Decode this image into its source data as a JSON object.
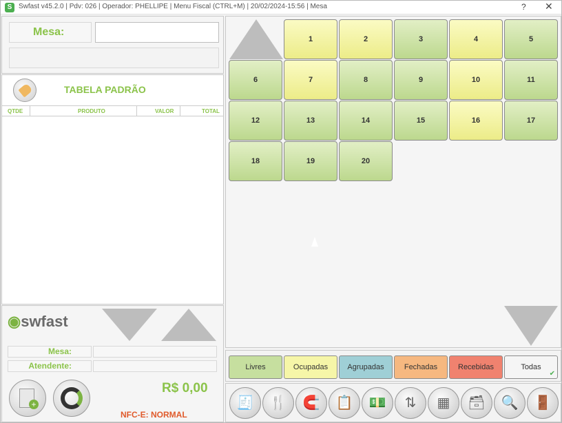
{
  "titlebar": {
    "title": "Swfast v45.2.0 | Pdv: 026 | Operador: PHELLIPE | Menu Fiscal (CTRL+M) | 20/02/2024-15:56 | Mesa",
    "help": "?",
    "close": "✕"
  },
  "left": {
    "mesa_label": "Mesa:",
    "table_title": "TABELA PADRÃO",
    "columns": [
      "QTDE",
      "PRODUTO",
      "VALOR",
      "TOTAL"
    ],
    "brand": "swfast",
    "info_mesa": "Mesa:",
    "info_atendente": "Atendente:",
    "total": "R$ 0,00",
    "nfce": "NFC-E: NORMAL"
  },
  "mesas": [
    {
      "n": "1",
      "status": "ocupada"
    },
    {
      "n": "2",
      "status": "ocupada"
    },
    {
      "n": "3",
      "status": "livre"
    },
    {
      "n": "4",
      "status": "ocupada"
    },
    {
      "n": "5",
      "status": "livre"
    },
    {
      "n": "6",
      "status": "livre"
    },
    {
      "n": "7",
      "status": "ocupada"
    },
    {
      "n": "8",
      "status": "livre"
    },
    {
      "n": "9",
      "status": "livre"
    },
    {
      "n": "10",
      "status": "ocupada"
    },
    {
      "n": "11",
      "status": "livre"
    },
    {
      "n": "12",
      "status": "livre"
    },
    {
      "n": "13",
      "status": "livre"
    },
    {
      "n": "14",
      "status": "livre"
    },
    {
      "n": "15",
      "status": "livre"
    },
    {
      "n": "16",
      "status": "ocupada"
    },
    {
      "n": "17",
      "status": "livre"
    },
    {
      "n": "18",
      "status": "livre"
    },
    {
      "n": "19",
      "status": "livre"
    },
    {
      "n": "20",
      "status": "livre"
    }
  ],
  "filters": [
    {
      "label": "Livres",
      "color": "#c6df9f"
    },
    {
      "label": "Ocupadas",
      "color": "#f6f6a8"
    },
    {
      "label": "Agrupadas",
      "color": "#9fcfd6"
    },
    {
      "label": "Fechadas",
      "color": "#f6b880"
    },
    {
      "label": "Recebidas",
      "color": "#f0826f"
    },
    {
      "label": "Todas",
      "color": "#f5f5f5"
    }
  ],
  "filter_check": "✔",
  "tools": [
    {
      "name": "cancel-receipt-icon",
      "glyph": "🧾"
    },
    {
      "name": "cutlery-icon",
      "glyph": "🍴"
    },
    {
      "name": "magnet-icon",
      "glyph": "🧲"
    },
    {
      "name": "clipboard-icon",
      "glyph": "📋"
    },
    {
      "name": "money-icon",
      "glyph": "💵"
    },
    {
      "name": "transfer-icon",
      "glyph": "⇅"
    },
    {
      "name": "group-tables-icon",
      "glyph": "▦"
    },
    {
      "name": "register-icon",
      "glyph": "🗃"
    },
    {
      "name": "search-icon",
      "glyph": "🔍"
    },
    {
      "name": "exit-icon",
      "glyph": "🚪"
    }
  ]
}
